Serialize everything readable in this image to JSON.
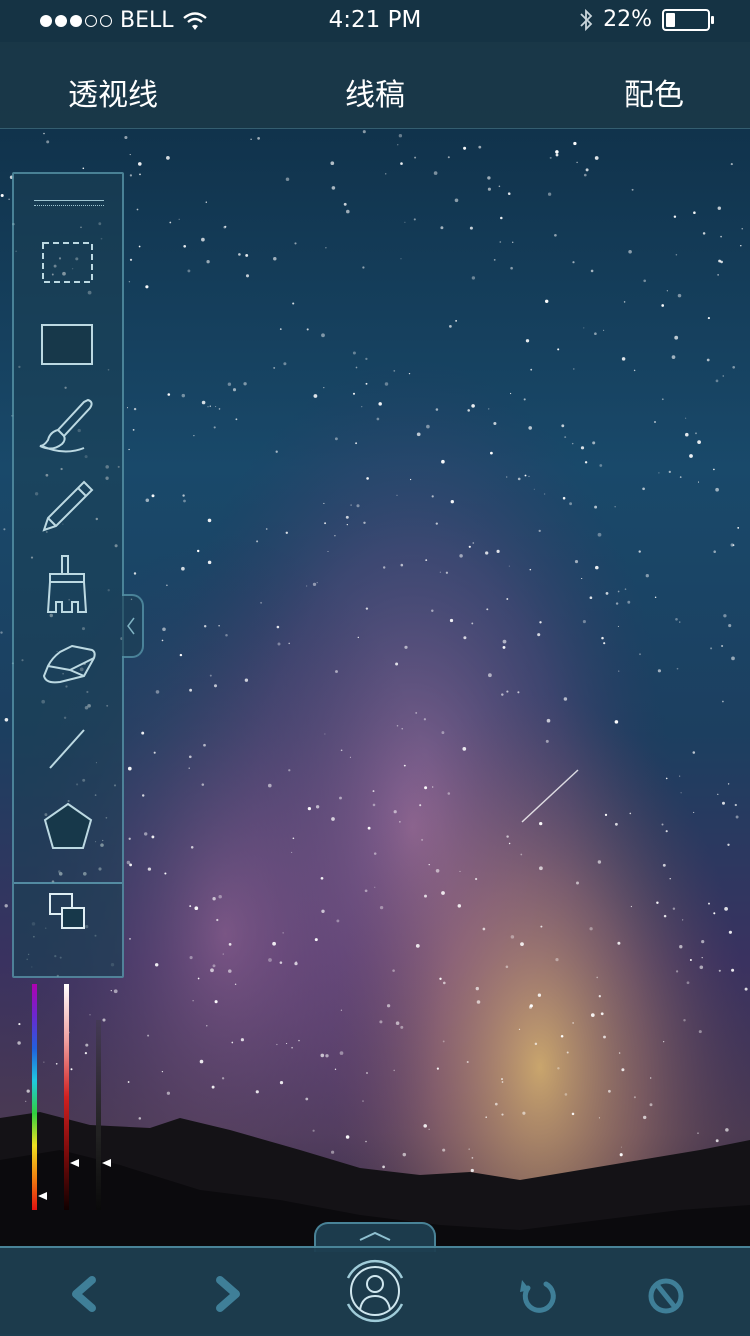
{
  "status_bar": {
    "carrier": "BELL",
    "time": "4:21 PM",
    "battery_percent": "22%",
    "battery_level": 0.22,
    "signal_dots_filled": 3,
    "signal_dots_total": 5
  },
  "top_tabs": {
    "perspective": "透视线",
    "lineart": "线稿",
    "color": "配色"
  },
  "toolbar": {
    "tools": [
      "marquee-select-icon",
      "rectangle-icon",
      "brush-icon",
      "pencil-icon",
      "flat-brush-icon",
      "eraser-icon",
      "line-icon",
      "pentagon-icon"
    ],
    "layers_icon": "layers-icon"
  },
  "color_sliders": {
    "hue_position": 0.94,
    "lightness_position": 0.79,
    "opacity_position": 0.75
  },
  "bottom_bar": {
    "icons": [
      "back-arrow-icon",
      "forward-arrow-icon",
      "profile-icon",
      "undo-icon",
      "reset-icon"
    ]
  },
  "colors": {
    "panel_bg": "#1b3848",
    "border_accent": "#5fa0b4",
    "icon_stroke": "#bcd9e2"
  }
}
